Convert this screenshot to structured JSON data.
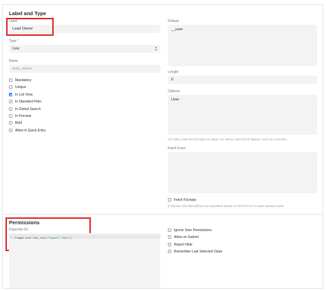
{
  "sections": {
    "label_type_title": "Label and Type",
    "permissions_title": "Permissions"
  },
  "fields": {
    "label": {
      "label": "Label",
      "value": "Lead Owner"
    },
    "type": {
      "label": "Type",
      "required_mark": "*",
      "value": "Link"
    },
    "name": {
      "label": "Name",
      "placeholder": "lead_owner"
    },
    "default": {
      "label": "Default",
      "value": "__user"
    },
    "length": {
      "label": "Length",
      "value": "0"
    },
    "options": {
      "label": "Options",
      "value": "User",
      "help": "For Links, enter the DocType as range. For Select, enter list of Options, each on a new line."
    },
    "fetch_from": {
      "label": "Fetch From",
      "value": ""
    },
    "fetch_if_empty": {
      "label": "Fetch If Empty",
      "checked": false,
      "help": "If checked, this field will be not overwritten based on Fetch From if a value already exists."
    },
    "depends_on": {
      "label": "Depends On",
      "code_line_no": "1",
      "code_prefix": "frappe.user.has_role(",
      "code_string": "\"Support Team\"",
      "code_suffix": ");"
    }
  },
  "left_checkboxes": [
    {
      "label": "Mandatory",
      "checked": false
    },
    {
      "label": "Unique",
      "checked": false
    },
    {
      "label": "In List View",
      "checked": true
    },
    {
      "label": "In Standard Filter",
      "checked": false
    },
    {
      "label": "In Global Search",
      "checked": false
    },
    {
      "label": "In Preview",
      "checked": false
    },
    {
      "label": "Bold",
      "checked": false
    },
    {
      "label": "Allow in Quick Entry",
      "checked": false
    }
  ],
  "permission_checkboxes": [
    {
      "label": "Ignore User Permissions",
      "checked": false
    },
    {
      "label": "Allow on Submit",
      "checked": false
    },
    {
      "label": "Report Hide",
      "checked": false
    },
    {
      "label": "Remember Last Selected Value",
      "checked": false
    }
  ],
  "colors": {
    "highlight": "#e02020",
    "accent": "#2d7ff9",
    "field_bg": "#f3f3f3"
  }
}
